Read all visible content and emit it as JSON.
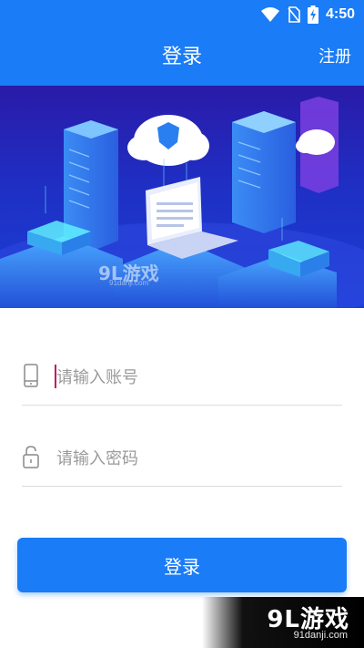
{
  "status_bar": {
    "time": "4:50",
    "icons": [
      "wifi-icon",
      "no-sim-icon",
      "battery-charging-icon"
    ]
  },
  "app_bar": {
    "title": "登录",
    "action_label": "注册"
  },
  "banner": {
    "watermark_logo": "9L游戏",
    "watermark_url": "91danji.com"
  },
  "form": {
    "account": {
      "placeholder": "请输入账号",
      "value": "",
      "icon": "phone-icon"
    },
    "password": {
      "placeholder": "请输入密码",
      "value": "",
      "icon": "lock-icon"
    },
    "submit_label": "登录"
  },
  "watermark": {
    "logo": "9L游戏",
    "url": "91danji.com"
  },
  "colors": {
    "primary": "#1a7cf6",
    "caret": "#c2185b"
  }
}
